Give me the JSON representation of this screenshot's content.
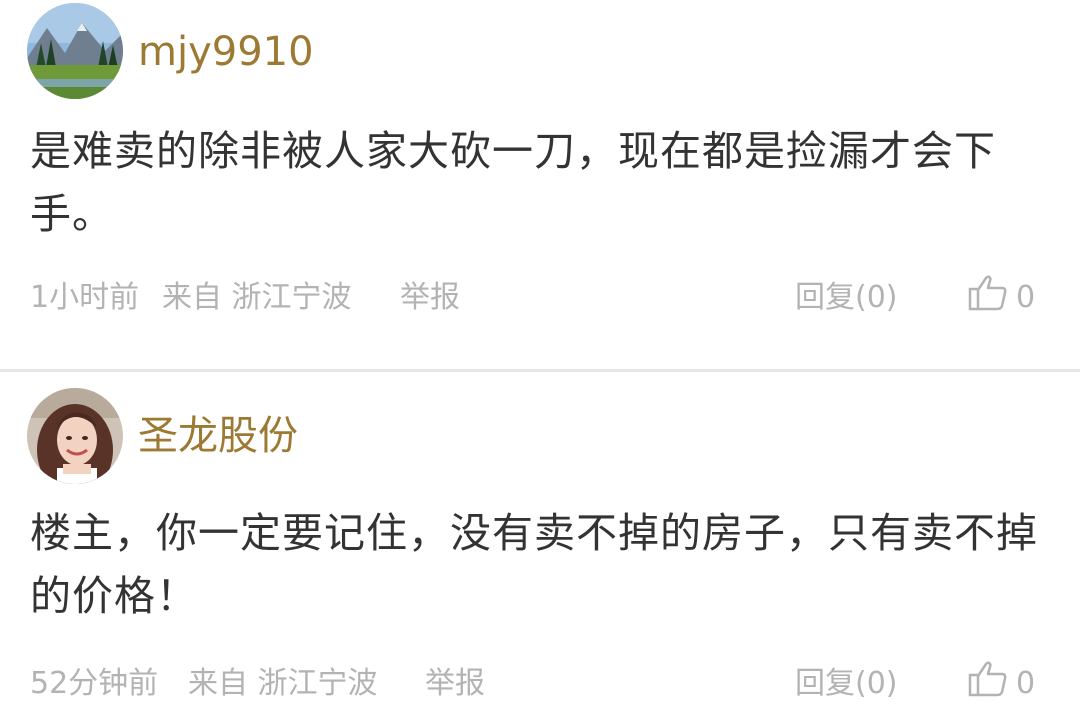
{
  "comments": [
    {
      "username": "mjy9910",
      "avatar": "landscape-avatar",
      "text": "是难卖的除非被人家大砍一刀，现在都是捡漏才会下手。",
      "time": "1小时前",
      "location": "来自 浙江宁波",
      "report_label": "举报",
      "reply_label": "回复(0)",
      "like_icon": "thumbs-up-icon",
      "like_count": "0"
    },
    {
      "username": "圣龙股份",
      "avatar": "portrait-avatar",
      "text": "楼主，你一定要记住，没有卖不掉的房子，只有卖不掉的价格！",
      "time": "52分钟前",
      "location": "来自 浙江宁波",
      "report_label": "举报",
      "reply_label": "回复(0)",
      "like_icon": "thumbs-up-icon",
      "like_count": "0"
    }
  ],
  "colors": {
    "username": "#9d7a33",
    "body_text": "#333333",
    "meta_text": "#b3b3b3",
    "divider": "#e6e6e6"
  }
}
